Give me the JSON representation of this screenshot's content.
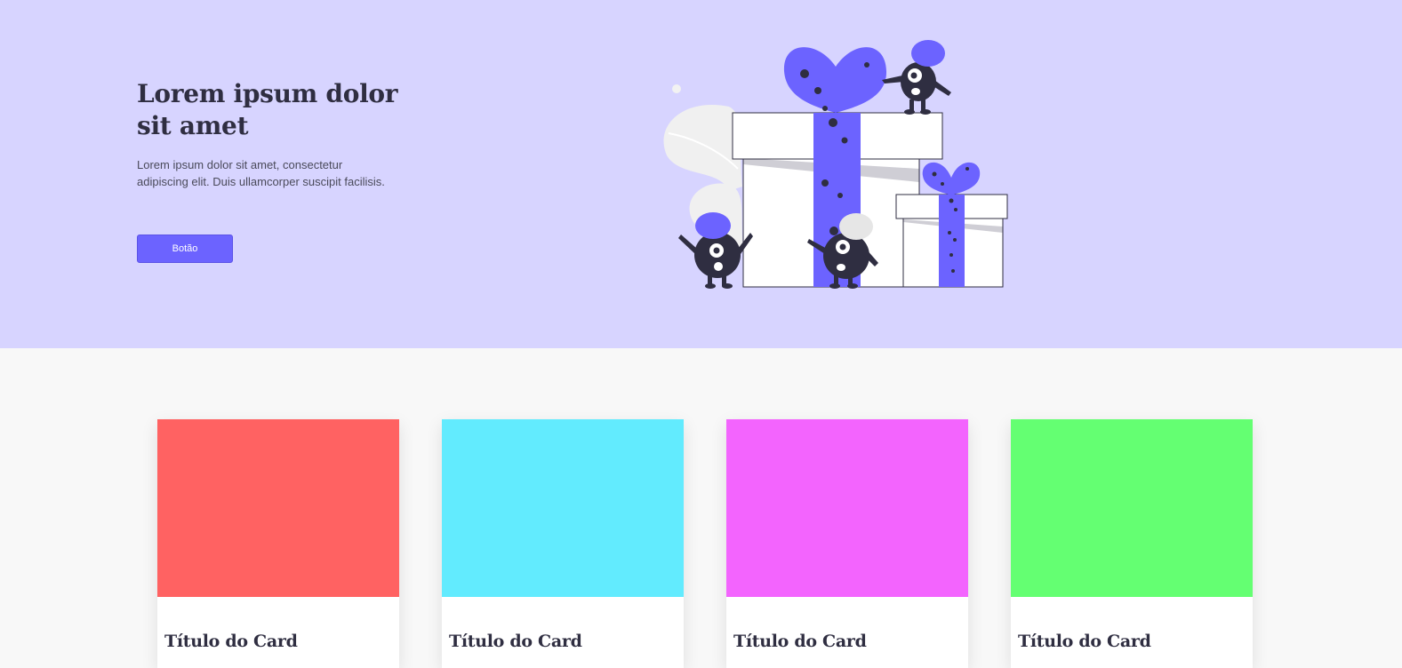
{
  "hero": {
    "title": "Lorem ipsum dolor sit amet",
    "description": "Lorem ipsum dolor sit amet, consectetur adipiscing elit. Duis ullamcorper suscipit facilisis.",
    "button_label": "Botão",
    "background_color": "#d7d4ff",
    "accent_color": "#6c63ff",
    "illustration": "gift-boxes-with-monsters-illustration"
  },
  "cards": [
    {
      "title": "Título do Card",
      "image_color": "#ff6262"
    },
    {
      "title": "Título do Card",
      "image_color": "#62ebfe"
    },
    {
      "title": "Título do Card",
      "image_color": "#f364fe"
    },
    {
      "title": "Título do Card",
      "image_color": "#64ff72"
    }
  ]
}
